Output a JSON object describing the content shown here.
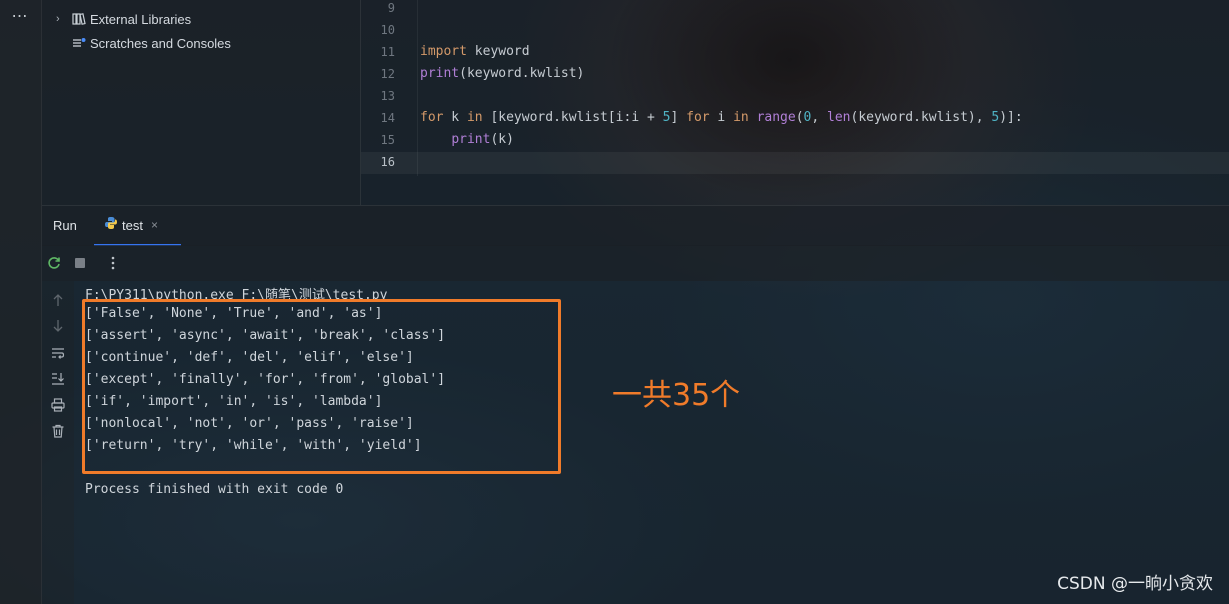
{
  "sidebar": {
    "more_label": "⋯"
  },
  "project_tree": {
    "items": [
      {
        "label": "External Libraries",
        "icon": "library-icon"
      },
      {
        "label": "Scratches and Consoles",
        "icon": "scratches-icon"
      }
    ]
  },
  "editor": {
    "line_numbers": [
      "9",
      "10",
      "11",
      "12",
      "13",
      "14",
      "15",
      "16"
    ],
    "current_line": "16",
    "code": {
      "l11_kw": "import",
      "l11_rest": " keyword",
      "l12_fn": "print",
      "l12_rest": "(keyword.kwlist)",
      "l14_kw1": "for",
      "l14_a": " k ",
      "l14_kw2": "in",
      "l14_b": " [keyword.kwlist[i:i + ",
      "l14_n1": "5",
      "l14_c": "] ",
      "l14_kw3": "for",
      "l14_d": " i ",
      "l14_kw4": "in",
      "l14_e": " ",
      "l14_fn1": "range",
      "l14_f": "(",
      "l14_n2": "0",
      "l14_g": ", ",
      "l14_fn2": "len",
      "l14_h": "(keyword.kwlist), ",
      "l14_n3": "5",
      "l14_i": ")]:",
      "l15_indent": "    ",
      "l15_fn": "print",
      "l15_rest": "(k)"
    }
  },
  "run_panel": {
    "label": "Run",
    "tab_label": "test",
    "tab_close": "×"
  },
  "toolbar": {
    "rerun_icon": "rerun-icon",
    "stop_icon": "stop-icon",
    "more_icon": "more-vertical-icon"
  },
  "console": {
    "command": "F:\\PY311\\python.exe F:\\随笔\\测试\\test.py",
    "output_lines": [
      "['False', 'None', 'True', 'and', 'as']",
      "['assert', 'async', 'await', 'break', 'class']",
      "['continue', 'def', 'del', 'elif', 'else']",
      "['except', 'finally', 'for', 'from', 'global']",
      "['if', 'import', 'in', 'is', 'lambda']",
      "['nonlocal', 'not', 'or', 'pass', 'raise']",
      "['return', 'try', 'while', 'with', 'yield']"
    ],
    "exit_message": "Process finished with exit code 0"
  },
  "annotation": {
    "text": "一共35个",
    "color": "#f07b2a"
  },
  "watermark": "CSDN @一晌小贪欢",
  "colors": {
    "tab_underline": "#3574f0",
    "keyword": "#d49a6a",
    "function": "#b07fd6",
    "number": "#4fb3c4"
  }
}
